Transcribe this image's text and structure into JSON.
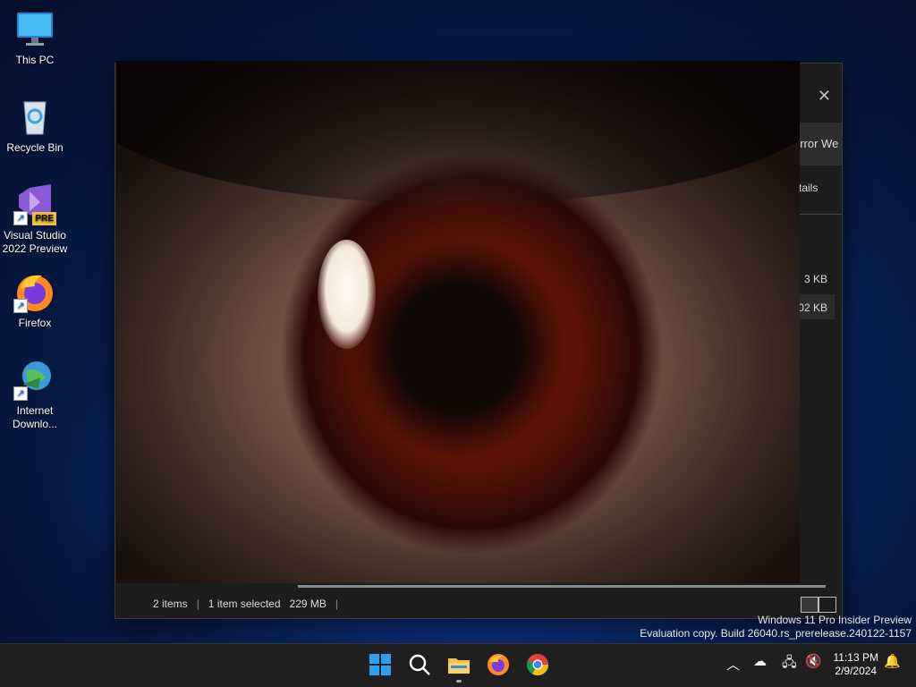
{
  "desktop": {
    "icons": [
      {
        "label": "This PC"
      },
      {
        "label": "Recycle Bin"
      },
      {
        "label": "Visual Studio 2022 Preview",
        "badge": "PRE"
      },
      {
        "label": "Firefox"
      },
      {
        "label": "Internet Downlo..."
      }
    ]
  },
  "explorer": {
    "tab_text": "orror We",
    "details_label": "tails",
    "file_sizes": [
      "3 KB",
      "02 KB"
    ],
    "status": {
      "items": "2 items",
      "selected": "1 item selected",
      "size": "229 MB"
    }
  },
  "watermark": {
    "line1": "Windows 11 Pro Insider Preview",
    "line2": "Evaluation copy. Build 26040.rs_prerelease.240122-1157"
  },
  "taskbar": {
    "pinned": [
      "start-icon",
      "search-icon",
      "file-explorer-icon",
      "firefox-icon",
      "chrome-icon"
    ],
    "clock": {
      "time": "11:13 PM",
      "date": "2/9/2024"
    }
  },
  "colors": {
    "accent": "#0078d4",
    "taskbar": "#1f1f1f"
  }
}
